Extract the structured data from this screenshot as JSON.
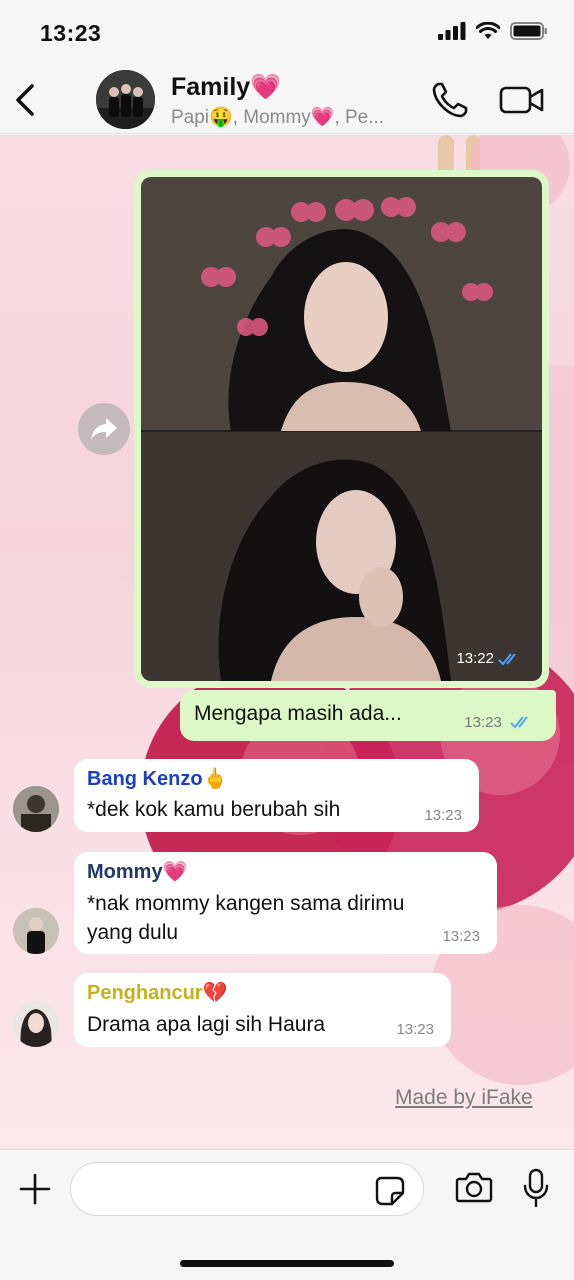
{
  "status_bar": {
    "time": "13:23"
  },
  "header": {
    "title": "Family💗",
    "members": "Papi🤑, Mommy💗, Pe..."
  },
  "messages": {
    "image": {
      "time": "13:22"
    },
    "outgoing": {
      "text": "Mengapa masih ada...",
      "time": "13:23"
    },
    "in1": {
      "sender": "Bang Kenzo🖕",
      "text": "*dek kok kamu berubah sih",
      "time": "13:23",
      "sender_color": "#1c3fc4"
    },
    "in2": {
      "sender": "Mommy💗",
      "text_line1": "*nak mommy kangen sama dirimu",
      "text_line2": "yang dulu",
      "time": "13:23",
      "sender_color": "#1e3a6b"
    },
    "in3": {
      "sender": "Penghancur💔",
      "text": "Drama apa lagi sih Haura",
      "time": "13:23",
      "sender_color": "#c5b11a"
    }
  },
  "watermark": "Made by iFake",
  "colors": {
    "outgoing_bubble": "#dcf8c6",
    "read_ticks": "#4fa3f7"
  },
  "icons": [
    "back-icon",
    "phone-icon",
    "video-icon",
    "forward-icon",
    "plus-icon",
    "sticker-icon",
    "camera-icon",
    "mic-icon"
  ]
}
